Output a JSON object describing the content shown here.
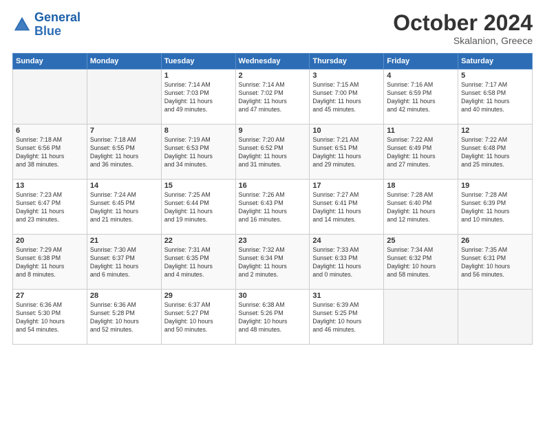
{
  "header": {
    "logo_line1": "General",
    "logo_line2": "Blue",
    "month": "October 2024",
    "location": "Skalanion, Greece"
  },
  "days_of_week": [
    "Sunday",
    "Monday",
    "Tuesday",
    "Wednesday",
    "Thursday",
    "Friday",
    "Saturday"
  ],
  "weeks": [
    [
      {
        "day": "",
        "empty": true
      },
      {
        "day": "",
        "empty": true
      },
      {
        "day": "1",
        "line1": "Sunrise: 7:14 AM",
        "line2": "Sunset: 7:03 PM",
        "line3": "Daylight: 11 hours",
        "line4": "and 49 minutes."
      },
      {
        "day": "2",
        "line1": "Sunrise: 7:14 AM",
        "line2": "Sunset: 7:02 PM",
        "line3": "Daylight: 11 hours",
        "line4": "and 47 minutes."
      },
      {
        "day": "3",
        "line1": "Sunrise: 7:15 AM",
        "line2": "Sunset: 7:00 PM",
        "line3": "Daylight: 11 hours",
        "line4": "and 45 minutes."
      },
      {
        "day": "4",
        "line1": "Sunrise: 7:16 AM",
        "line2": "Sunset: 6:59 PM",
        "line3": "Daylight: 11 hours",
        "line4": "and 42 minutes."
      },
      {
        "day": "5",
        "line1": "Sunrise: 7:17 AM",
        "line2": "Sunset: 6:58 PM",
        "line3": "Daylight: 11 hours",
        "line4": "and 40 minutes."
      }
    ],
    [
      {
        "day": "6",
        "line1": "Sunrise: 7:18 AM",
        "line2": "Sunset: 6:56 PM",
        "line3": "Daylight: 11 hours",
        "line4": "and 38 minutes."
      },
      {
        "day": "7",
        "line1": "Sunrise: 7:18 AM",
        "line2": "Sunset: 6:55 PM",
        "line3": "Daylight: 11 hours",
        "line4": "and 36 minutes."
      },
      {
        "day": "8",
        "line1": "Sunrise: 7:19 AM",
        "line2": "Sunset: 6:53 PM",
        "line3": "Daylight: 11 hours",
        "line4": "and 34 minutes."
      },
      {
        "day": "9",
        "line1": "Sunrise: 7:20 AM",
        "line2": "Sunset: 6:52 PM",
        "line3": "Daylight: 11 hours",
        "line4": "and 31 minutes."
      },
      {
        "day": "10",
        "line1": "Sunrise: 7:21 AM",
        "line2": "Sunset: 6:51 PM",
        "line3": "Daylight: 11 hours",
        "line4": "and 29 minutes."
      },
      {
        "day": "11",
        "line1": "Sunrise: 7:22 AM",
        "line2": "Sunset: 6:49 PM",
        "line3": "Daylight: 11 hours",
        "line4": "and 27 minutes."
      },
      {
        "day": "12",
        "line1": "Sunrise: 7:22 AM",
        "line2": "Sunset: 6:48 PM",
        "line3": "Daylight: 11 hours",
        "line4": "and 25 minutes."
      }
    ],
    [
      {
        "day": "13",
        "line1": "Sunrise: 7:23 AM",
        "line2": "Sunset: 6:47 PM",
        "line3": "Daylight: 11 hours",
        "line4": "and 23 minutes."
      },
      {
        "day": "14",
        "line1": "Sunrise: 7:24 AM",
        "line2": "Sunset: 6:45 PM",
        "line3": "Daylight: 11 hours",
        "line4": "and 21 minutes."
      },
      {
        "day": "15",
        "line1": "Sunrise: 7:25 AM",
        "line2": "Sunset: 6:44 PM",
        "line3": "Daylight: 11 hours",
        "line4": "and 19 minutes."
      },
      {
        "day": "16",
        "line1": "Sunrise: 7:26 AM",
        "line2": "Sunset: 6:43 PM",
        "line3": "Daylight: 11 hours",
        "line4": "and 16 minutes."
      },
      {
        "day": "17",
        "line1": "Sunrise: 7:27 AM",
        "line2": "Sunset: 6:41 PM",
        "line3": "Daylight: 11 hours",
        "line4": "and 14 minutes."
      },
      {
        "day": "18",
        "line1": "Sunrise: 7:28 AM",
        "line2": "Sunset: 6:40 PM",
        "line3": "Daylight: 11 hours",
        "line4": "and 12 minutes."
      },
      {
        "day": "19",
        "line1": "Sunrise: 7:28 AM",
        "line2": "Sunset: 6:39 PM",
        "line3": "Daylight: 11 hours",
        "line4": "and 10 minutes."
      }
    ],
    [
      {
        "day": "20",
        "line1": "Sunrise: 7:29 AM",
        "line2": "Sunset: 6:38 PM",
        "line3": "Daylight: 11 hours",
        "line4": "and 8 minutes."
      },
      {
        "day": "21",
        "line1": "Sunrise: 7:30 AM",
        "line2": "Sunset: 6:37 PM",
        "line3": "Daylight: 11 hours",
        "line4": "and 6 minutes."
      },
      {
        "day": "22",
        "line1": "Sunrise: 7:31 AM",
        "line2": "Sunset: 6:35 PM",
        "line3": "Daylight: 11 hours",
        "line4": "and 4 minutes."
      },
      {
        "day": "23",
        "line1": "Sunrise: 7:32 AM",
        "line2": "Sunset: 6:34 PM",
        "line3": "Daylight: 11 hours",
        "line4": "and 2 minutes."
      },
      {
        "day": "24",
        "line1": "Sunrise: 7:33 AM",
        "line2": "Sunset: 6:33 PM",
        "line3": "Daylight: 11 hours",
        "line4": "and 0 minutes."
      },
      {
        "day": "25",
        "line1": "Sunrise: 7:34 AM",
        "line2": "Sunset: 6:32 PM",
        "line3": "Daylight: 10 hours",
        "line4": "and 58 minutes."
      },
      {
        "day": "26",
        "line1": "Sunrise: 7:35 AM",
        "line2": "Sunset: 6:31 PM",
        "line3": "Daylight: 10 hours",
        "line4": "and 56 minutes."
      }
    ],
    [
      {
        "day": "27",
        "line1": "Sunrise: 6:36 AM",
        "line2": "Sunset: 5:30 PM",
        "line3": "Daylight: 10 hours",
        "line4": "and 54 minutes."
      },
      {
        "day": "28",
        "line1": "Sunrise: 6:36 AM",
        "line2": "Sunset: 5:28 PM",
        "line3": "Daylight: 10 hours",
        "line4": "and 52 minutes."
      },
      {
        "day": "29",
        "line1": "Sunrise: 6:37 AM",
        "line2": "Sunset: 5:27 PM",
        "line3": "Daylight: 10 hours",
        "line4": "and 50 minutes."
      },
      {
        "day": "30",
        "line1": "Sunrise: 6:38 AM",
        "line2": "Sunset: 5:26 PM",
        "line3": "Daylight: 10 hours",
        "line4": "and 48 minutes."
      },
      {
        "day": "31",
        "line1": "Sunrise: 6:39 AM",
        "line2": "Sunset: 5:25 PM",
        "line3": "Daylight: 10 hours",
        "line4": "and 46 minutes."
      },
      {
        "day": "",
        "empty": true
      },
      {
        "day": "",
        "empty": true
      }
    ]
  ]
}
